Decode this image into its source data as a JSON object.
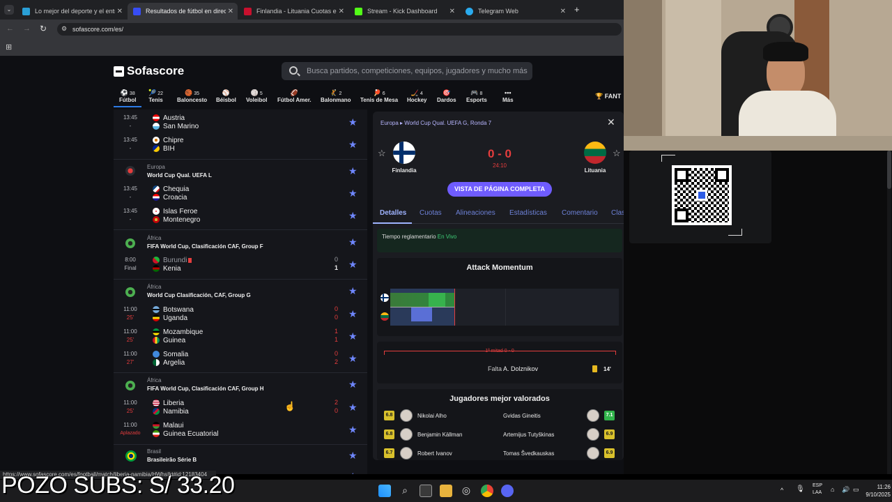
{
  "browser": {
    "tabs": [
      {
        "label": "Lo mejor del deporte y el entre",
        "color": "#2a9fd6"
      },
      {
        "label": "Resultados de fútbol en directo",
        "color": "#374df5"
      },
      {
        "label": "Finlandia - Lituania Cuotas en V",
        "color": "#c8102e"
      },
      {
        "label": "Stream - Kick Dashboard",
        "color": "#53fc18"
      },
      {
        "label": "Telegram Web",
        "color": "#2aabee"
      }
    ],
    "url": "sofascore.com/es/",
    "status_url": "https://www.sofascore.com/es/football/match/liberia-namibia/HWhsIkt#id:12183404"
  },
  "site": {
    "logo": "Sofascore",
    "search_placeholder": "Busca partidos, competiciones, equipos, jugadores y mucho más",
    "fantasy": "FANT"
  },
  "sports": [
    {
      "name": "Fútbol",
      "count": "38",
      "icon": "⚽"
    },
    {
      "name": "Tenis",
      "count": "22",
      "icon": "🎾"
    },
    {
      "name": "Baloncesto",
      "count": "35",
      "icon": "🏀"
    },
    {
      "name": "Béisbol",
      "count": "",
      "icon": "⚾"
    },
    {
      "name": "Voleibol",
      "count": "5",
      "icon": "🏐"
    },
    {
      "name": "Fútbol Amer.",
      "count": "",
      "icon": "🏈"
    },
    {
      "name": "Balonmano",
      "count": "2",
      "icon": "🤾"
    },
    {
      "name": "Tenis de Mesa",
      "count": "6",
      "icon": "🏓"
    },
    {
      "name": "Hockey",
      "count": "4",
      "icon": "🏒"
    },
    {
      "name": "Dardos",
      "count": "",
      "icon": "🎯"
    },
    {
      "name": "Esports",
      "count": "8",
      "icon": "🎮"
    },
    {
      "name": "Más",
      "count": "",
      "icon": "•••"
    }
  ],
  "list": {
    "matches_top": [
      {
        "time": "13:45",
        "status": "-",
        "home": "Austria",
        "away": "San Marino"
      },
      {
        "time": "13:45",
        "status": "-",
        "home": "Chipre",
        "away": "BIH"
      }
    ],
    "league1": {
      "region": "Europa",
      "name": "World Cup Qual. UEFA L"
    },
    "matches_l1": [
      {
        "time": "13:45",
        "status": "-",
        "home": "Chequia",
        "away": "Croacia"
      },
      {
        "time": "13:45",
        "status": "-",
        "home": "Islas Feroe",
        "away": "Montenegro"
      }
    ],
    "league2": {
      "region": "África",
      "name": "FIFA World Cup, Clasificación CAF, Group F"
    },
    "matches_l2": [
      {
        "time": "8:00",
        "status": "Final",
        "home": "Burundi",
        "away": "Kenia",
        "hs": "0",
        "as": "1"
      }
    ],
    "league3": {
      "region": "África",
      "name": "World Cup Clasificación, CAF, Group G"
    },
    "matches_l3": [
      {
        "time": "11:00",
        "status": "25'",
        "home": "Botswana",
        "away": "Uganda",
        "hs": "0",
        "as": "0"
      },
      {
        "time": "11:00",
        "status": "25'",
        "home": "Mozambique",
        "away": "Guinea",
        "hs": "1",
        "as": "1"
      },
      {
        "time": "11:00",
        "status": "27'",
        "home": "Somalia",
        "away": "Argelia",
        "hs": "0",
        "as": "2"
      }
    ],
    "league4": {
      "region": "África",
      "name": "FIFA World Cup, Clasificación CAF, Group H"
    },
    "matches_l4": [
      {
        "time": "11:00",
        "status": "25'",
        "home": "Liberia",
        "away": "Namibia",
        "hs": "2",
        "as": "0"
      },
      {
        "time": "11:00",
        "status": "Aplazado",
        "home": "Malaui",
        "away": "Guinea Ecuatorial"
      }
    ],
    "league5": {
      "region": "Brasil",
      "name": "Brasileirão Série B"
    }
  },
  "panel": {
    "crumb_region": "Europa",
    "crumb_comp": "World Cup Qual. UEFA G, Ronda 7",
    "home": "Finlandia",
    "away": "Lituania",
    "score": "0 - 0",
    "clock": "24:10",
    "full_button": "VISTA DE PÁGINA COMPLETA",
    "tabs": [
      "Detalles",
      "Cuotas",
      "Alineaciones",
      "Estadísticas",
      "Comentario",
      "Clas"
    ],
    "reg_time": "Tiempo reglamentario",
    "live": "En Vivo",
    "attack_title": "Attack Momentum",
    "half": "1ª mitad 0 - 0",
    "event_type": "Falta",
    "event_player": "A. Dolznikov",
    "event_minute": "14'",
    "top_title": "Jugadores mejor valorados",
    "top_home": [
      {
        "name": "Nikolai Alho",
        "rating": "6.8"
      },
      {
        "name": "Benjamin Källman",
        "rating": "6.8"
      },
      {
        "name": "Robert Ivanov",
        "rating": "6.7"
      }
    ],
    "top_away": [
      {
        "name": "Gvidas Gineitis",
        "rating": "7.1"
      },
      {
        "name": "Artemijus Tutyškinas",
        "rating": "6.9"
      },
      {
        "name": "Tomas Švedkauskas",
        "rating": "6.9"
      }
    ]
  },
  "overlay": "POZO SUBS: S/ 33.20",
  "taskbar": {
    "lang1": "ESP",
    "lang2": "LAA",
    "time": "11:26",
    "date": "9/10/2025"
  }
}
